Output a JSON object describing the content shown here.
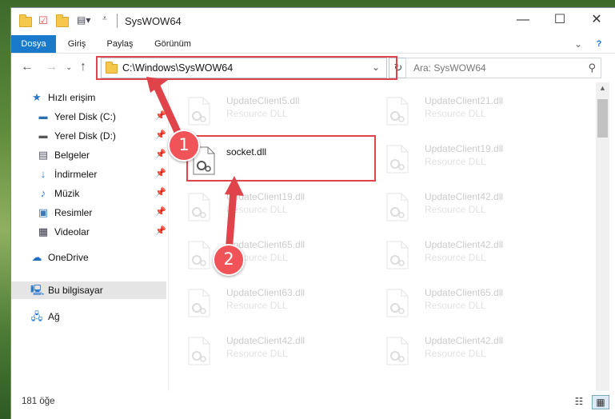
{
  "window": {
    "title": "SysWOW64",
    "minimize": "—",
    "maximize": "☐",
    "close": "✕"
  },
  "ribbon": {
    "tabs": [
      "Dosya",
      "Giriş",
      "Paylaş",
      "Görünüm"
    ],
    "help": "?"
  },
  "nav": {
    "address": "C:\\Windows\\SysWOW64",
    "search_placeholder": "Ara: SysWOW64"
  },
  "sidebar": {
    "quick_access": "Hızlı erişim",
    "items": [
      {
        "label": "Yerel Disk (C:)"
      },
      {
        "label": "Yerel Disk (D:)"
      },
      {
        "label": "Belgeler"
      },
      {
        "label": "İndirmeler"
      },
      {
        "label": "Müzik"
      },
      {
        "label": "Resimler"
      },
      {
        "label": "Videolar"
      }
    ],
    "onedrive": "OneDrive",
    "this_pc": "Bu bilgisayar",
    "network": "Ağ"
  },
  "files": {
    "highlighted": {
      "name": "socket.dll"
    },
    "left": [
      {
        "name": "UpdateClient5.dll",
        "type": "Resource DLL"
      },
      {
        "name": "UpdateClient19.dll",
        "type": "Resource DLL"
      },
      {
        "name": "UpdateClient65.dll",
        "type": "Resource DLL"
      },
      {
        "name": "UpdateClient63.dll",
        "type": "Resource DLL"
      },
      {
        "name": "UpdateClient42.dll",
        "type": "Resource DLL"
      }
    ],
    "right": [
      {
        "name": "UpdateClient21.dll",
        "type": "Resource DLL"
      },
      {
        "name": "UpdateClient19.dll",
        "type": "Resource DLL"
      },
      {
        "name": "UpdateClient42.dll",
        "type": "Resource DLL"
      },
      {
        "name": "UpdateClient42.dll",
        "type": "Resource DLL"
      },
      {
        "name": "UpdateClient65.dll",
        "type": "Resource DLL"
      },
      {
        "name": "UpdateClient42.dll",
        "type": "Resource DLL"
      }
    ]
  },
  "status": {
    "count": "181 öğe"
  },
  "annotations": {
    "step1": "1",
    "step2": "2",
    "color": "#e0434a"
  }
}
